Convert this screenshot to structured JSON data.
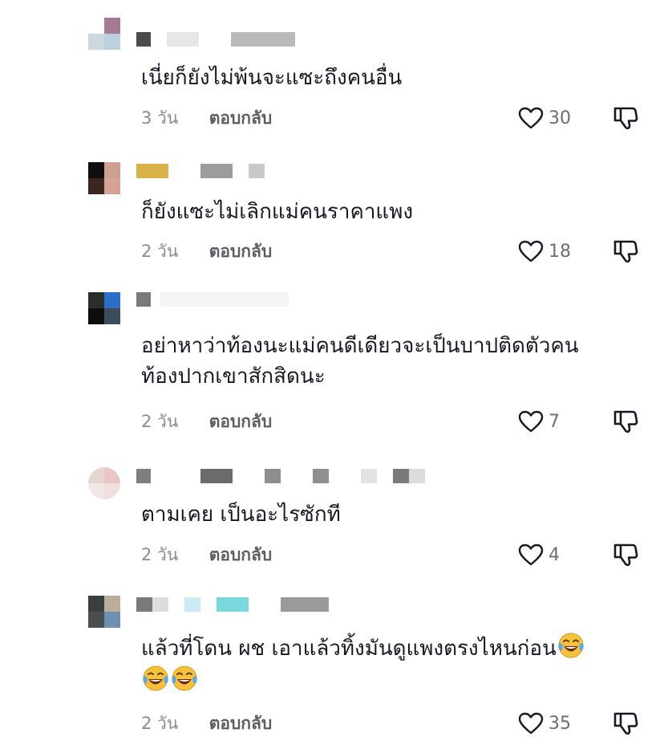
{
  "comments": [
    {
      "text": "เนี่ยก็ยังไม่พ้นจะแซะถึงคนอื่น",
      "time": "3 วัน",
      "reply": "ตอบกลับ",
      "likes": "30"
    },
    {
      "text": "ก็ยังแซะไม่เลิกแม่คนราคาแพง",
      "time": "2 วัน",
      "reply": "ตอบกลับ",
      "likes": "18"
    },
    {
      "text_line1": "อย่าหาว่าท้องนะแม่คนดีเดียวจะเป็นบาปติดตัวคน",
      "text_line2": "ท้องปากเขาสักสิดนะ",
      "time": "2 วัน",
      "reply": "ตอบกลับ",
      "likes": "7"
    },
    {
      "text": "ตามเคย เป็นอะไรซักที",
      "time": "2 วัน",
      "reply": "ตอบกลับ",
      "likes": "4"
    },
    {
      "text_line1": "แล้วที่โดน ผช เอาแล้วทิ้งมันดูแพงตรงไหนก่อน",
      "time": "2 วัน",
      "reply": "ตอบกลับ",
      "likes": "35"
    }
  ],
  "icons": {
    "like": "heart-outline-icon",
    "dislike": "thumbs-down-outline-icon",
    "emoji": "laughing-tears-emoji"
  },
  "colors": {
    "meta_text": "#8a8b91",
    "reply_text": "#5c5d63",
    "body_text": "#161823"
  }
}
